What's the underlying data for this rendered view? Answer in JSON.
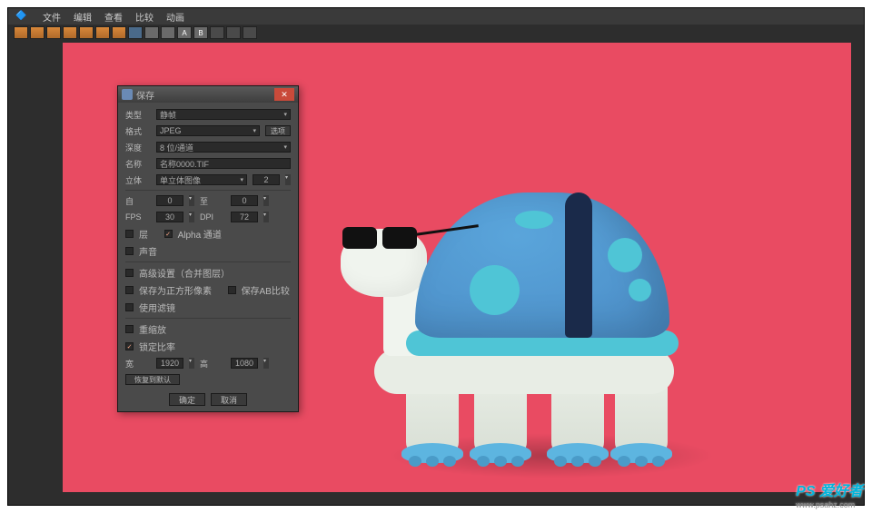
{
  "menubar": {
    "items": [
      "文件",
      "编辑",
      "查看",
      "比较",
      "动画"
    ]
  },
  "toolbar": {
    "buttons": [
      "t1",
      "t2",
      "t3",
      "t4",
      "t5",
      "t6",
      "t7",
      "t8",
      "t9",
      "t10",
      "tA",
      "tB",
      "t13",
      "t14",
      "t15"
    ]
  },
  "dialog": {
    "title": "保存",
    "type_label": "类型",
    "type_value": "静帧",
    "format_label": "格式",
    "format_value": "JPEG",
    "options_btn": "选项",
    "depth_label": "深度",
    "depth_value": "8 位/通道",
    "name_label": "名称",
    "name_value": "名称0000.TIF",
    "stereo_label": "立体",
    "stereo_value": "单立体图像",
    "stereo_num": "2",
    "from_label": "自",
    "from_value": "0",
    "to_label": "至",
    "to_value": "0",
    "fps_label": "FPS",
    "fps_value": "30",
    "dpi_label": "DPI",
    "dpi_value": "72",
    "layer_label": "层",
    "alpha_label": "Alpha 通道",
    "alpha_checked": true,
    "sound_label": "声音",
    "adv_label": "高级设置（合并图层）",
    "square_label": "保存为正方形像素",
    "ab_label": "保存AB比较",
    "filter_label": "使用滤镜",
    "scale_label": "重缩放",
    "lock_label": "锁定比率",
    "lock_checked": true,
    "width_label": "宽",
    "width_value": "1920",
    "height_label": "高",
    "height_value": "1080",
    "reset_btn": "恢复到默认",
    "ok": "确定",
    "cancel": "取消"
  },
  "watermark": {
    "brand": "PS 爱好者",
    "url": "www.psahz.com"
  }
}
